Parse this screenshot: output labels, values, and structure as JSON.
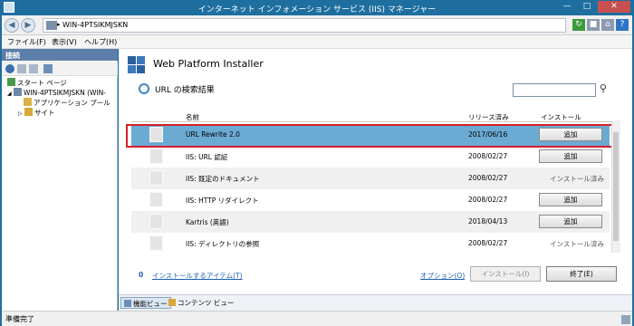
{
  "window": {
    "title": "インターネット インフォメーション サービス (IIS) マネージャー"
  },
  "address": {
    "path": "WIN-4PTSIKMJSKN",
    "separator": "▸"
  },
  "menu": [
    "ファイル(F)",
    "表示(V)",
    "ヘルプ(H)"
  ],
  "connections": {
    "header": "接続",
    "tree": [
      {
        "label": "スタート ページ"
      },
      {
        "label": "WIN-4PTSIKMJSKN (WIN-"
      },
      {
        "label": "アプリケーション プール"
      },
      {
        "label": "サイト"
      }
    ]
  },
  "main": {
    "title": "Web Platform Installer",
    "subtitle": "URL の検索結果",
    "search_value": "",
    "columns": {
      "name": "名前",
      "release": "リリース済み",
      "install": "インストール"
    },
    "rows": [
      {
        "name": "URL Rewrite 2.0",
        "date": "2017/06/16",
        "action": "追加"
      },
      {
        "name": "IIS: URL 認証",
        "date": "2008/02/27",
        "action": "追加"
      },
      {
        "name": "IIS: 既定のドキュメント",
        "date": "2008/02/27",
        "action": "インストール済み"
      },
      {
        "name": "IIS: HTTP リダイレクト",
        "date": "2008/02/27",
        "action": "追加"
      },
      {
        "name": "Kartris (英語)",
        "date": "2018/04/13",
        "action": "追加"
      },
      {
        "name": "IIS: ディレクトリの参照",
        "date": "2008/02/27",
        "action": "インストール済み"
      }
    ],
    "footer": {
      "count": "0",
      "items_link": "インストールするアイテム(T)",
      "options_link": "オプション(O)",
      "install_button": "インストール(I)",
      "finish_button": "終了(E)"
    }
  },
  "view_tabs": {
    "features": "機能ビュー",
    "content": "コンテンツ ビュー"
  },
  "status": {
    "text": "準備完了"
  },
  "colors": {
    "frame": "#1e6f9f",
    "selection": "#6baad2",
    "highlight_box": "#d2202a",
    "link": "#1a5fb4"
  }
}
